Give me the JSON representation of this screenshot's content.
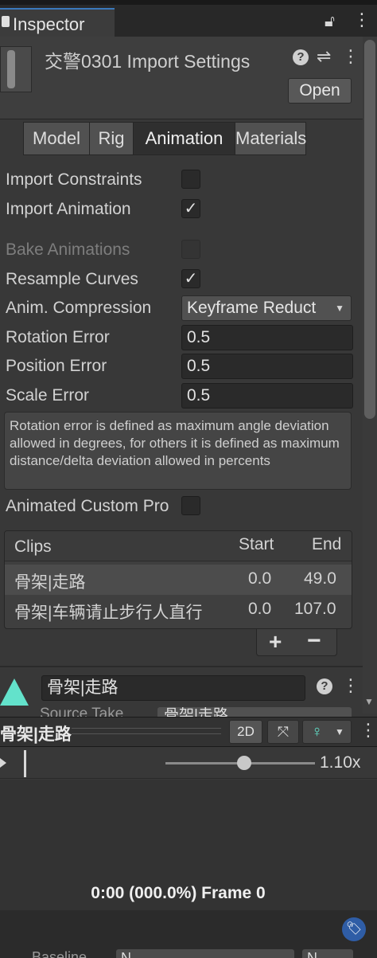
{
  "window": {
    "tab_label": "Inspector"
  },
  "header": {
    "title": "交警0301 Import Settings",
    "open_label": "Open"
  },
  "tabs": [
    {
      "label": "Model"
    },
    {
      "label": "Rig"
    },
    {
      "label": "Animation",
      "active": true
    },
    {
      "label": "Materials"
    }
  ],
  "fields": {
    "import_constraints": {
      "label": "Import Constraints",
      "checked": false
    },
    "import_animation": {
      "label": "Import Animation",
      "checked": true
    },
    "bake_animations": {
      "label": "Bake Animations",
      "checked": false,
      "disabled": true
    },
    "resample_curves": {
      "label": "Resample Curves",
      "checked": true
    },
    "anim_compression": {
      "label": "Anim. Compression",
      "value": "Keyframe Reduct"
    },
    "rotation_error": {
      "label": "Rotation Error",
      "value": "0.5"
    },
    "position_error": {
      "label": "Position Error",
      "value": "0.5"
    },
    "scale_error": {
      "label": "Scale Error",
      "value": "0.5"
    },
    "animated_custom": {
      "label": "Animated Custom Pro",
      "checked": false
    }
  },
  "help_text": "Rotation error is defined as maximum angle deviation allowed in degrees, for others it is defined as maximum distance/delta deviation allowed in percents",
  "clips": {
    "header": {
      "name": "Clips",
      "start": "Start",
      "end": "End"
    },
    "rows": [
      {
        "name": "骨架|走路",
        "start": "0.0",
        "end": "49.0",
        "selected": true
      },
      {
        "name": "骨架|车辆请止步行人直行",
        "start": "0.0",
        "end": "107.0",
        "selected": false
      }
    ],
    "add_label": "+",
    "remove_label": "−"
  },
  "clip_editor": {
    "name": "骨架|走路",
    "partial_label": "Source Take",
    "partial_value": "骨架|走路"
  },
  "preview": {
    "title": "骨架|走路",
    "mode_2d": "2D",
    "speed": "1.10x",
    "frame_info": "0:00 (000.0%) Frame 0",
    "bottom_partial_label": "Baseline",
    "bottom_field1": "N",
    "bottom_field2": "N",
    "accent": "#63e2cb"
  },
  "colors": {
    "background": "#383838",
    "accent_blue": "#3a79bb"
  }
}
